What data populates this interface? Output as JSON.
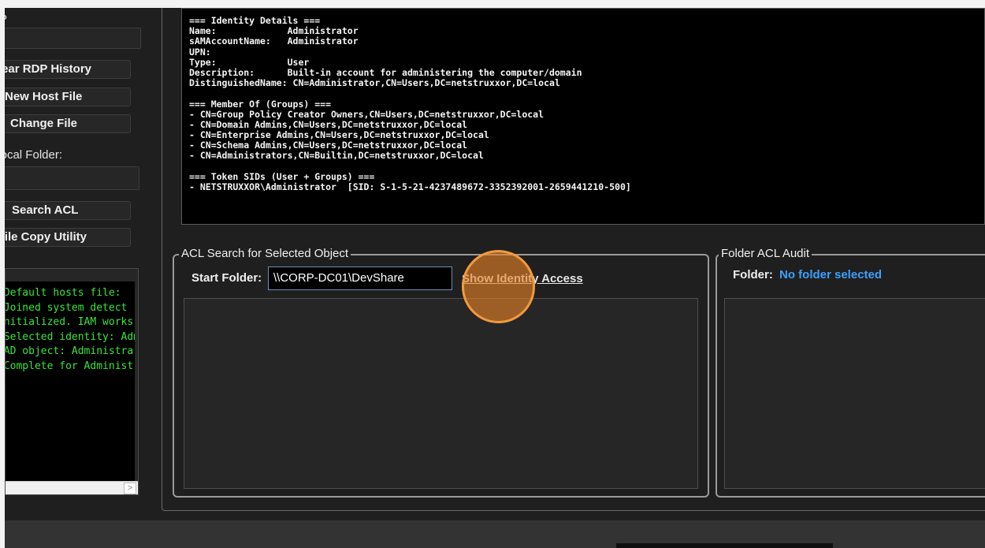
{
  "left_panel": {
    "top_label": "Host Name or IP:",
    "clear_rdp_label": "Clear RDP History",
    "new_host_file_label": "New Host File",
    "change_file_label": "Change File",
    "local_folder_label": "Local Folder:",
    "search_acl_label": "Search ACL",
    "file_copy_label": "File Copy Utility",
    "log_lines": [
      "Default hosts file:",
      "Joined system detect",
      "nitialized. IAM works",
      "Selected identity: Adm",
      "AD object: Administra",
      "Complete for Administ"
    ]
  },
  "identity_details": {
    "lines": [
      "=== Identity Details ===",
      "Name:             Administrator",
      "sAMAccountName:   Administrator",
      "UPN:",
      "Type:             User",
      "Description:      Built-in account for administering the computer/domain",
      "DistinguishedName: CN=Administrator,CN=Users,DC=netstruxxor,DC=local",
      "",
      "=== Member Of (Groups) ===",
      "- CN=Group Policy Creator Owners,CN=Users,DC=netstruxxor,DC=local",
      "- CN=Domain Admins,CN=Users,DC=netstruxxor,DC=local",
      "- CN=Enterprise Admins,CN=Users,DC=netstruxxor,DC=local",
      "- CN=Schema Admins,CN=Users,DC=netstruxxor,DC=local",
      "- CN=Administrators,CN=Builtin,DC=netstruxxor,DC=local",
      "",
      "=== Token SIDs (User + Groups) ===",
      "- NETSTRUXXOR\\Administrator  [SID: S-1-5-21-4237489672-3352392001-2659441210-500]"
    ]
  },
  "acl_search": {
    "title": "ACL Search for Selected Object",
    "start_folder_label": "Start Folder:",
    "start_folder_value": "\\\\CORP-DC01\\DevShare",
    "show_identity_access_label": "Show Identity Access"
  },
  "folder_audit": {
    "title": "Folder ACL Audit",
    "folder_label": "Folder:",
    "folder_value": "No folder selected",
    "folder_value_color": "#3ba1ff"
  },
  "colors": {
    "highlight": "#f29a3c",
    "log_text": "#39e639",
    "background": "#1f1f1f"
  }
}
